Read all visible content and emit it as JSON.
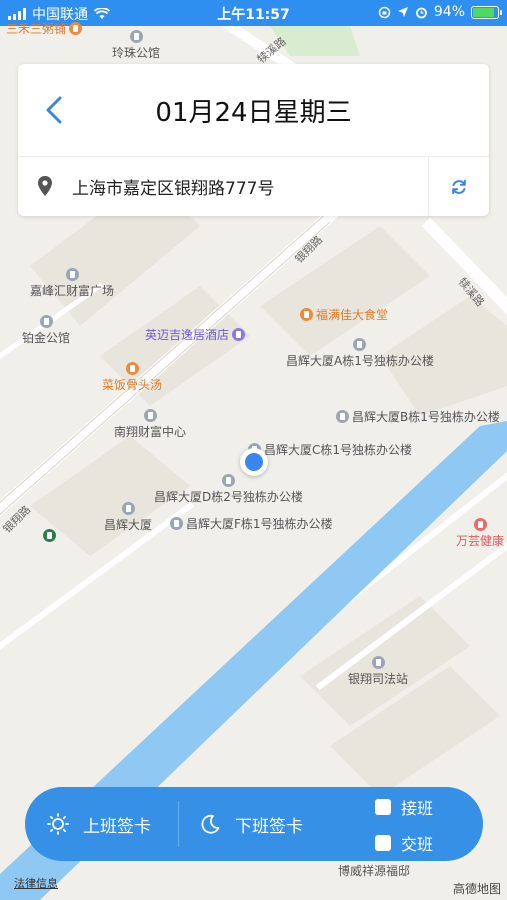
{
  "status_bar": {
    "carrier": "中国联通",
    "time": "上午11:57",
    "battery": "94%",
    "battery_level": 0.94
  },
  "header": {
    "back_icon": "chevron-left-icon",
    "title": "01月24日星期三"
  },
  "location": {
    "pin_icon": "location-pin-icon",
    "address": "上海市嘉定区银翔路777号",
    "refresh_icon": "refresh-icon"
  },
  "map": {
    "roads": [
      "银翔路",
      "银翔路",
      "犊溪路",
      "犊溪路"
    ],
    "pois": [
      {
        "label": "三禾三粥铺",
        "kind": "orange"
      },
      {
        "label": "玲珠公馆",
        "kind": "grey"
      },
      {
        "label": "嘉峰汇财富广场",
        "kind": "grey"
      },
      {
        "label": "铂金公馆",
        "kind": "grey"
      },
      {
        "label": "福满佳大食堂",
        "kind": "orange"
      },
      {
        "label": "英迈吉逸居酒店",
        "kind": "purple"
      },
      {
        "label": "昌辉大厦A栋1号独栋办公楼",
        "kind": "grey"
      },
      {
        "label": "菜饭骨头汤",
        "kind": "orange"
      },
      {
        "label": "昌辉大厦B栋1号独栋办公楼",
        "kind": "grey"
      },
      {
        "label": "南翔财富中心",
        "kind": "grey"
      },
      {
        "label": "昌辉大厦C栋1号独栋办公楼",
        "kind": "grey"
      },
      {
        "label": "昌辉大厦D栋2号独栋办公楼",
        "kind": "grey"
      },
      {
        "label": "昌辉大厦",
        "kind": "grey"
      },
      {
        "label": "昌辉大厦F栋1号独栋办公楼",
        "kind": "grey"
      },
      {
        "label": "万芸健康",
        "kind": "red"
      },
      {
        "label": "银翔司法站",
        "kind": "grey"
      },
      {
        "label": "博威祥源福邸",
        "kind": "grey"
      }
    ],
    "legal_text": "法律信息",
    "provider": "高德地图"
  },
  "actions": {
    "clock_in_icon": "sun-icon",
    "clock_in": "上班签卡",
    "clock_out_icon": "moon-icon",
    "clock_out": "下班签卡",
    "handover": "接班",
    "shift_change": "交班"
  },
  "colors": {
    "accent": "#3691e6",
    "status_bar": "#2e8ff0",
    "river": "#8fc8f2",
    "location_dot": "#3a86f0"
  }
}
